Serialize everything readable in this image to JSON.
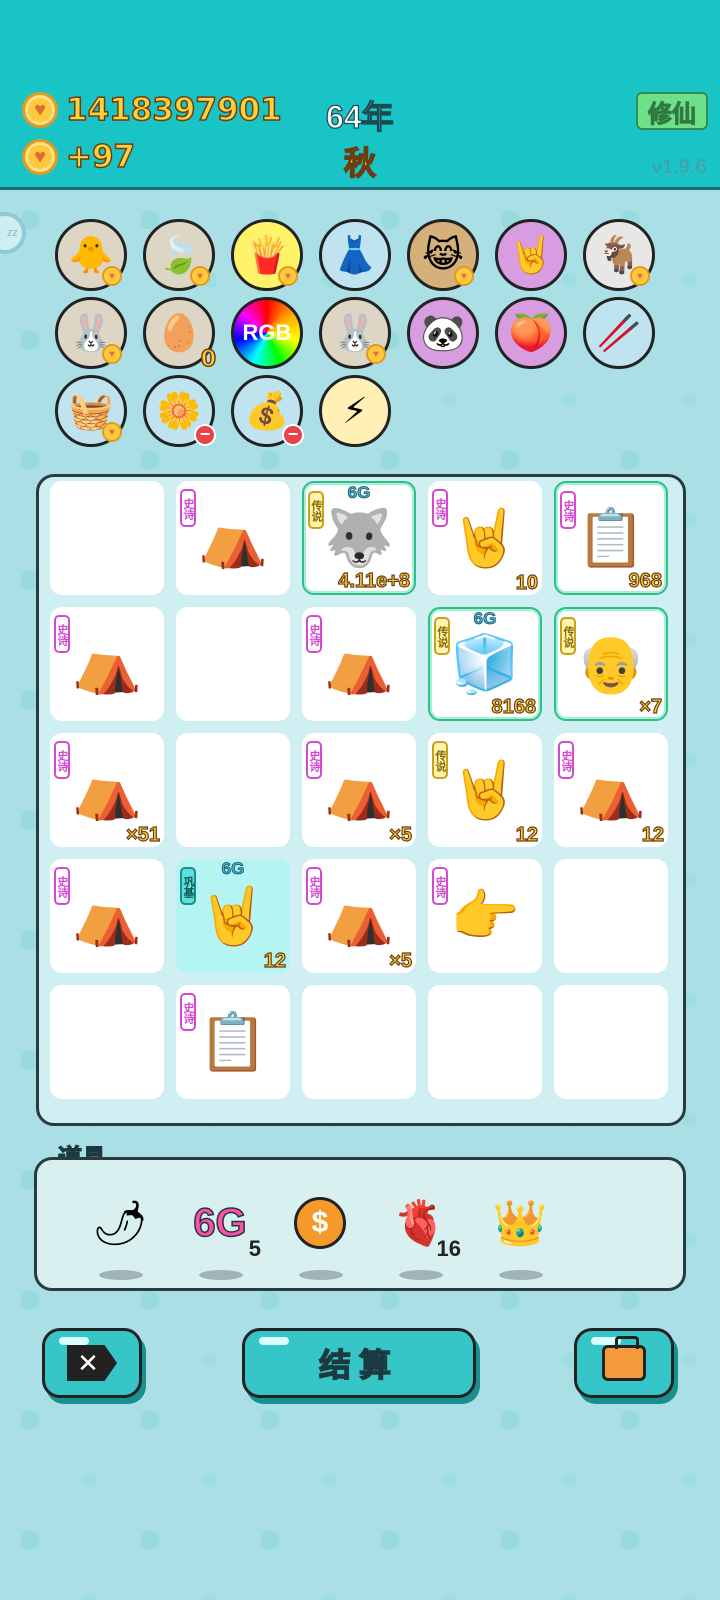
{
  "header": {
    "coins_total": "1418397901",
    "coins_rate": "+97",
    "year": "64年",
    "season": "秋",
    "cultivate_button": "修仙",
    "version": "v1.9.6"
  },
  "sleep_button": "zz",
  "owned_items": [
    {
      "icon": "chick-egg-icon",
      "glyph": "🐥",
      "bg": "#ddd6c4",
      "badge": "heart"
    },
    {
      "icon": "leaf-icon",
      "glyph": "🍃",
      "bg": "#ddd6c4",
      "badge": "heart"
    },
    {
      "icon": "fries-icon",
      "glyph": "🍟",
      "bg": "#fff36a",
      "badge": "heart"
    },
    {
      "icon": "skirt-icon",
      "glyph": "👗",
      "bg": "#bfe4ef",
      "badge": ""
    },
    {
      "icon": "cats-face-icon",
      "glyph": "😹",
      "bg": "#d6b07a",
      "badge": "heart"
    },
    {
      "icon": "rock-hand-icon",
      "glyph": "🤘",
      "bg": "#d79de0",
      "badge": ""
    },
    {
      "icon": "goats-icon",
      "glyph": "🐐",
      "bg": "#e9e6e6",
      "badge": "heart"
    },
    {
      "icon": "rabbit-icon",
      "glyph": "🐰",
      "bg": "#ddd6c4",
      "badge": "heart"
    },
    {
      "icon": "egg-tray-icon",
      "glyph": "🥚",
      "bg": "#ddd6c4",
      "badge": "zero",
      "count": "0"
    },
    {
      "icon": "rgb-icon",
      "glyph": "RGB",
      "bg": "rainbow",
      "badge": ""
    },
    {
      "icon": "rabbit-icon",
      "glyph": "🐰",
      "bg": "#ddd6c4",
      "badge": "heart"
    },
    {
      "icon": "panda-icon",
      "glyph": "🐼",
      "bg": "#d79de0",
      "badge": ""
    },
    {
      "icon": "fruit-bundle-icon",
      "glyph": "🍑",
      "bg": "#d79de0",
      "badge": ""
    },
    {
      "icon": "sticks-icon",
      "glyph": "🥢",
      "bg": "#bfe4ef",
      "badge": ""
    },
    {
      "icon": "fruit-basket-icon",
      "glyph": "🧺",
      "bg": "#bfe4ef",
      "badge": "heart"
    },
    {
      "icon": "potted-flower-icon",
      "glyph": "🌼",
      "bg": "#bfe4ef",
      "badge": "minus"
    },
    {
      "icon": "sack-icon",
      "glyph": "💰",
      "bg": "#bfe4ef",
      "badge": "minus"
    },
    {
      "icon": "lightning-icon",
      "glyph": "⚡",
      "bg": "#fff0b5",
      "badge": ""
    }
  ],
  "board": {
    "cells": [
      {
        "empty": true
      },
      {
        "tag": "史诗",
        "tier": "epic",
        "icon": "rabbit-tent-icon",
        "glyph": "⛺",
        "count": ""
      },
      {
        "tag": "传说",
        "tier": "leg",
        "icon": "husky-king-icon",
        "glyph": "🐺",
        "g6": "6G",
        "count": "4.11e+8",
        "legend": true
      },
      {
        "tag": "史诗",
        "tier": "epic",
        "icon": "rock-hand-gray-icon",
        "glyph": "🤘",
        "count": "10"
      },
      {
        "tag": "史诗",
        "tier": "epic",
        "icon": "copy-paste-icon",
        "glyph": "📋",
        "count": "968",
        "legend": true
      },
      {
        "tag": "史诗",
        "tier": "epic",
        "icon": "rabbit-tent-icon",
        "glyph": "⛺",
        "count": ""
      },
      {
        "empty": true
      },
      {
        "tag": "史诗",
        "tier": "epic",
        "icon": "rabbit-tent-icon",
        "glyph": "⛺",
        "count": ""
      },
      {
        "tag": "传说",
        "tier": "leg",
        "icon": "fridge-king-icon",
        "glyph": "🧊",
        "g6": "6G",
        "count": "8168",
        "legend": true
      },
      {
        "tag": "传说",
        "tier": "leg",
        "icon": "grandpa-king-icon",
        "glyph": "👴",
        "count": "×7",
        "legend": true
      },
      {
        "tag": "史诗",
        "tier": "epic",
        "icon": "rabbit-tent-icon",
        "glyph": "⛺",
        "count": "×51"
      },
      {
        "empty": true
      },
      {
        "tag": "史诗",
        "tier": "epic",
        "icon": "rabbit-tent-icon",
        "glyph": "⛺",
        "count": "×5"
      },
      {
        "tag": "传说",
        "tier": "leg",
        "icon": "rock-hand-yellow-icon",
        "glyph": "🤘",
        "count": "12"
      },
      {
        "tag": "史诗",
        "tier": "epic",
        "icon": "rabbit-tent-icon",
        "glyph": "⛺",
        "count": "12"
      },
      {
        "tag": "史诗",
        "tier": "epic",
        "icon": "rabbit-tent-icon",
        "glyph": "⛺",
        "count": ""
      },
      {
        "tag": "巩基",
        "tier": "str",
        "icon": "rock-hand-yellow-icon",
        "glyph": "🤘",
        "g6": "6G",
        "count": "12",
        "cyan": true
      },
      {
        "tag": "史诗",
        "tier": "epic",
        "icon": "rabbit-tent-icon",
        "glyph": "⛺",
        "count": "×5"
      },
      {
        "tag": "史诗",
        "tier": "epic",
        "icon": "point-hand-icon",
        "glyph": "👉",
        "count": ""
      },
      {
        "empty": true
      },
      {
        "empty": true
      },
      {
        "tag": "史诗",
        "tier": "epic",
        "icon": "copy-paste-icon",
        "glyph": "📋",
        "count": ""
      },
      {
        "empty": true
      },
      {
        "empty": true
      },
      {
        "empty": true
      }
    ]
  },
  "props": {
    "label": "道具",
    "items": [
      {
        "icon": "chili-icon",
        "glyph": "🌶",
        "count": ""
      },
      {
        "icon": "6g-icon",
        "glyph": "6G",
        "count": "5"
      },
      {
        "icon": "dollar-coin-icon",
        "glyph": "$",
        "count": ""
      },
      {
        "icon": "liver-icon",
        "glyph": "🫀",
        "count": "16"
      },
      {
        "icon": "crown-icon",
        "glyph": "👑",
        "count": ""
      }
    ]
  },
  "buttons": {
    "exit": "✕",
    "settle": "结算",
    "bag": ""
  }
}
